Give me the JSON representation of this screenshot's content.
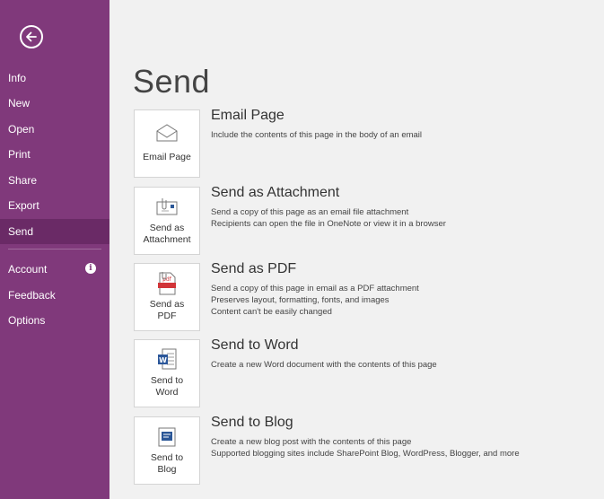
{
  "sidebar": {
    "items": [
      {
        "label": "Info"
      },
      {
        "label": "New"
      },
      {
        "label": "Open"
      },
      {
        "label": "Print"
      },
      {
        "label": "Share"
      },
      {
        "label": "Export"
      },
      {
        "label": "Send",
        "active": true
      },
      {
        "label": "Account"
      },
      {
        "label": "Feedback"
      },
      {
        "label": "Options"
      }
    ],
    "info_badge": "i"
  },
  "main": {
    "title": "Send",
    "options": [
      {
        "tile_label": "Email Page",
        "title": "Email Page",
        "desc1": "Include the contents of this page in the body of an email",
        "desc2": "",
        "desc3": "",
        "icon": "envelope-icon"
      },
      {
        "tile_label": "Send as Attachment",
        "title": "Send as Attachment",
        "desc1": "Send a copy of this page as an email file attachment",
        "desc2": "Recipients can open the file in OneNote or view it in a browser",
        "desc3": "",
        "icon": "attachment-icon"
      },
      {
        "tile_label": "Send as PDF",
        "title": "Send as PDF",
        "desc1": "Send a copy of this page in email as a PDF attachment",
        "desc2": "Preserves layout, formatting, fonts, and images",
        "desc3": "Content can't be easily changed",
        "icon": "pdf-icon"
      },
      {
        "tile_label": "Send to Word",
        "title": "Send to Word",
        "desc1": "Create a new Word document with the contents of this page",
        "desc2": "",
        "desc3": "",
        "icon": "word-icon"
      },
      {
        "tile_label": "Send to Blog",
        "title": "Send to Blog",
        "desc1": "Create a new blog post with the contents of this page",
        "desc2": "Supported blogging sites include SharePoint Blog, WordPress, Blogger, and more",
        "desc3": "",
        "icon": "blog-icon"
      }
    ],
    "tile_lines": [
      [
        "Email Page"
      ],
      [
        "Send as",
        "Attachment"
      ],
      [
        "Send as",
        "PDF"
      ],
      [
        "Send to",
        "Word"
      ],
      [
        "Send to",
        "Blog"
      ]
    ]
  },
  "colors": {
    "sidebar": "#80397b",
    "sidebar_active": "#6a2a66",
    "background": "#f1f1f1"
  }
}
